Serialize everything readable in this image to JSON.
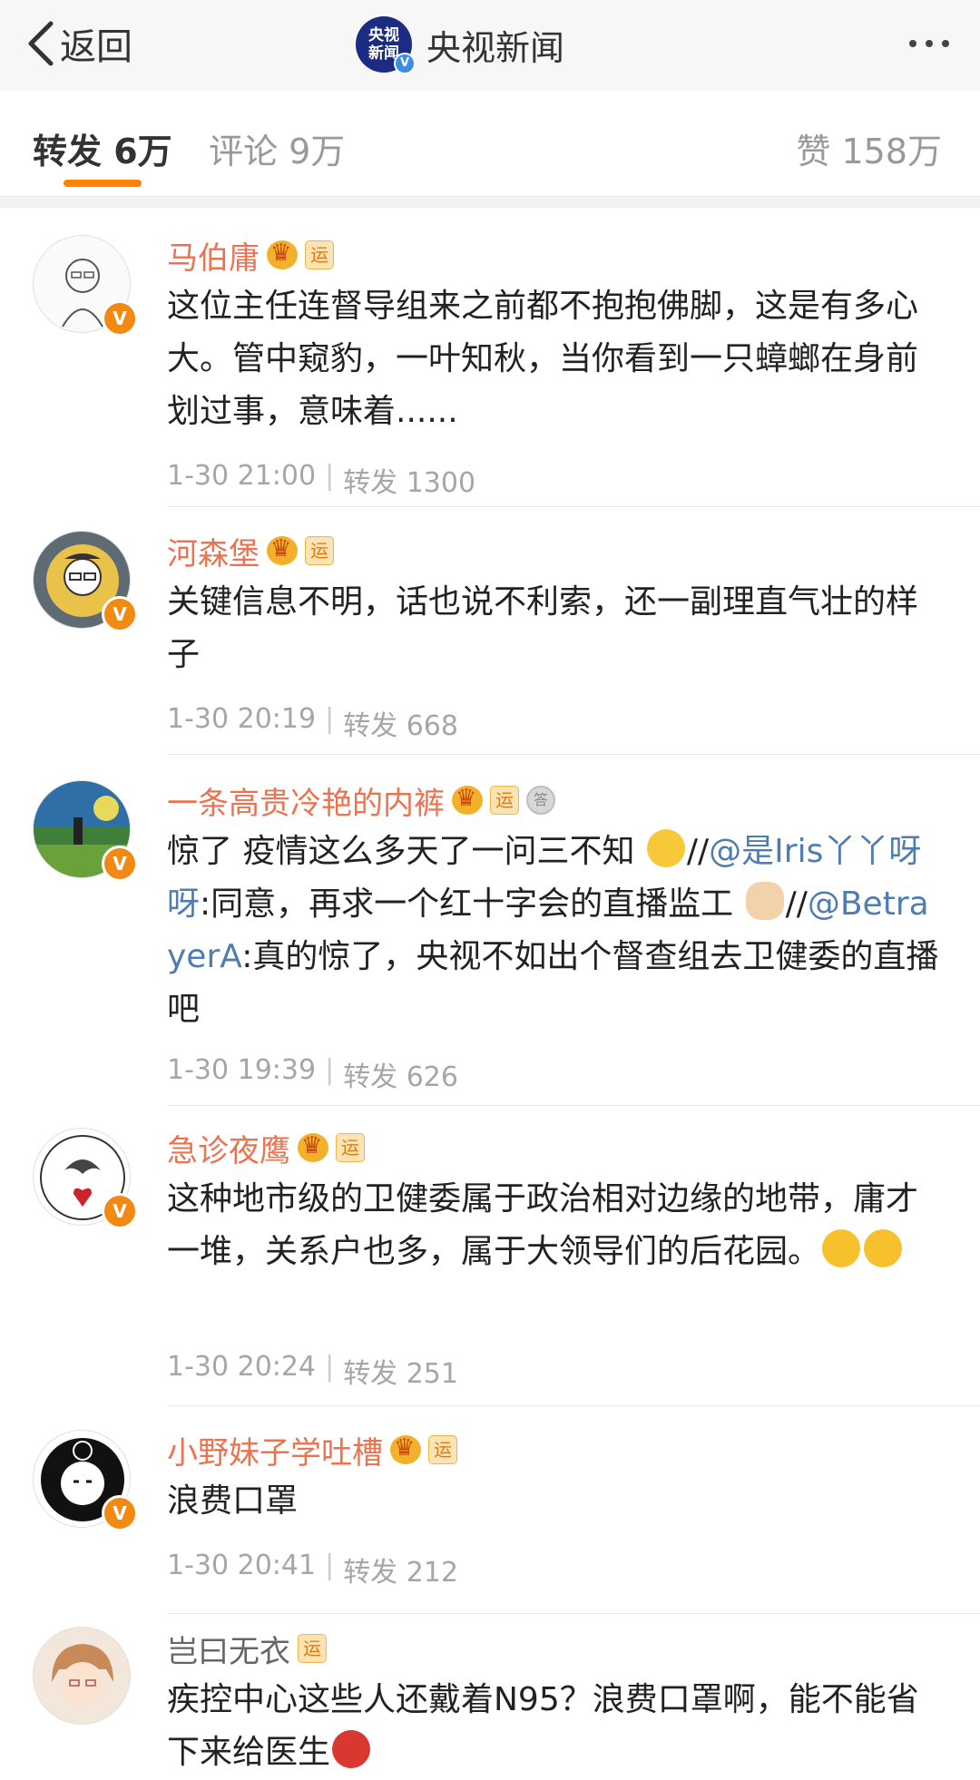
{
  "nav": {
    "back_label": "返回",
    "logo_text_1": "央视",
    "logo_text_2": "新闻",
    "title": "央视新闻",
    "more_icon": "ellipsis-icon"
  },
  "tabs": {
    "repost": "转发 6万",
    "comment": "评论 9万",
    "like": "赞 158万",
    "accent": "#ff8200"
  },
  "reposts": [
    {
      "name": "马伯庸",
      "text": "这位主任连督导组来之前都不抱抱佛脚，这是有多心大。管中窥豹，一叶知秋，当你看到一只蟑螂在身前划过事，意味着......",
      "time": "1-30 21:00",
      "repost": "转发 1300"
    },
    {
      "name": "河森堡",
      "text": "关键信息不明，话也说不利索，还一副理直气壮的样子",
      "time": "1-30 20:19",
      "repost": "转发 668"
    },
    {
      "name": "一条高贵冷艳的内裤",
      "text_a": "惊了 疫情这么多天了一问三不知 ",
      "text_b": "//",
      "mention_1": "@是Iris丫丫呀呀",
      "text_c": ":同意，再求一个红十字会的直播监工 ",
      "text_d": "//",
      "mention_2": "@BetrayerA",
      "text_e": ":真的惊了，央视不如出个督查组去卫健委的直播吧",
      "time": "1-30 19:39",
      "repost": "转发 626"
    },
    {
      "name": "急诊夜鹰",
      "text": "这种地市级的卫健委属于政治相对边缘的地带，庸才一堆，关系户也多，属于大领导们的后花园。",
      "time": "1-30 20:24",
      "repost": "转发 251"
    },
    {
      "name": "小野妹子学吐槽",
      "text": "浪费口罩",
      "time": "1-30 20:41",
      "repost": "转发 212"
    },
    {
      "name": "岂曰无衣",
      "text": "疾控中心这些人还戴着N95？浪费口罩啊，能不能省下来给医生",
      "time": "",
      "repost": ""
    }
  ],
  "badge_yun": "运",
  "badge_verified": "V",
  "badge_medal": "答"
}
